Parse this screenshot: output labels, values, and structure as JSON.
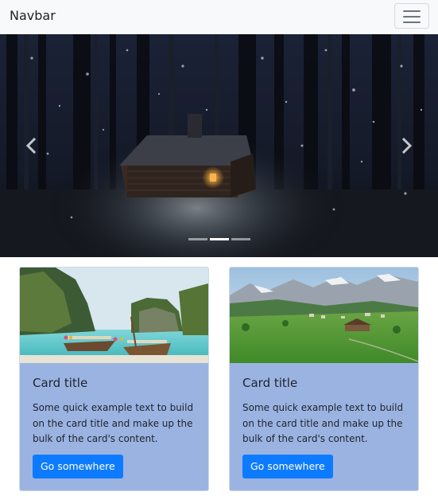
{
  "navbar": {
    "brand": "Navbar",
    "toggler_icon": "hamburger-menu-icon"
  },
  "carousel": {
    "image": "snowy-forest-cabin-at-night",
    "prev_icon": "chevron-left-icon",
    "next_icon": "chevron-right-icon",
    "slide_count": 3,
    "active_index": 1
  },
  "cards": [
    {
      "image": "longtail-boats-tropical-beach",
      "title": "Card title",
      "text": "Some quick example text to build on the card title and make up the bulk of the card's content.",
      "button": "Go somewhere"
    },
    {
      "image": "green-alpine-valley-village",
      "title": "Card title",
      "text": "Some quick example text to build on the card title and make up the bulk of the card's content.",
      "button": "Go somewhere"
    }
  ],
  "colors": {
    "navbar_bg": "#f8f9fa",
    "card_bg": "#9bb3e0",
    "button_bg": "#0d7bff"
  }
}
